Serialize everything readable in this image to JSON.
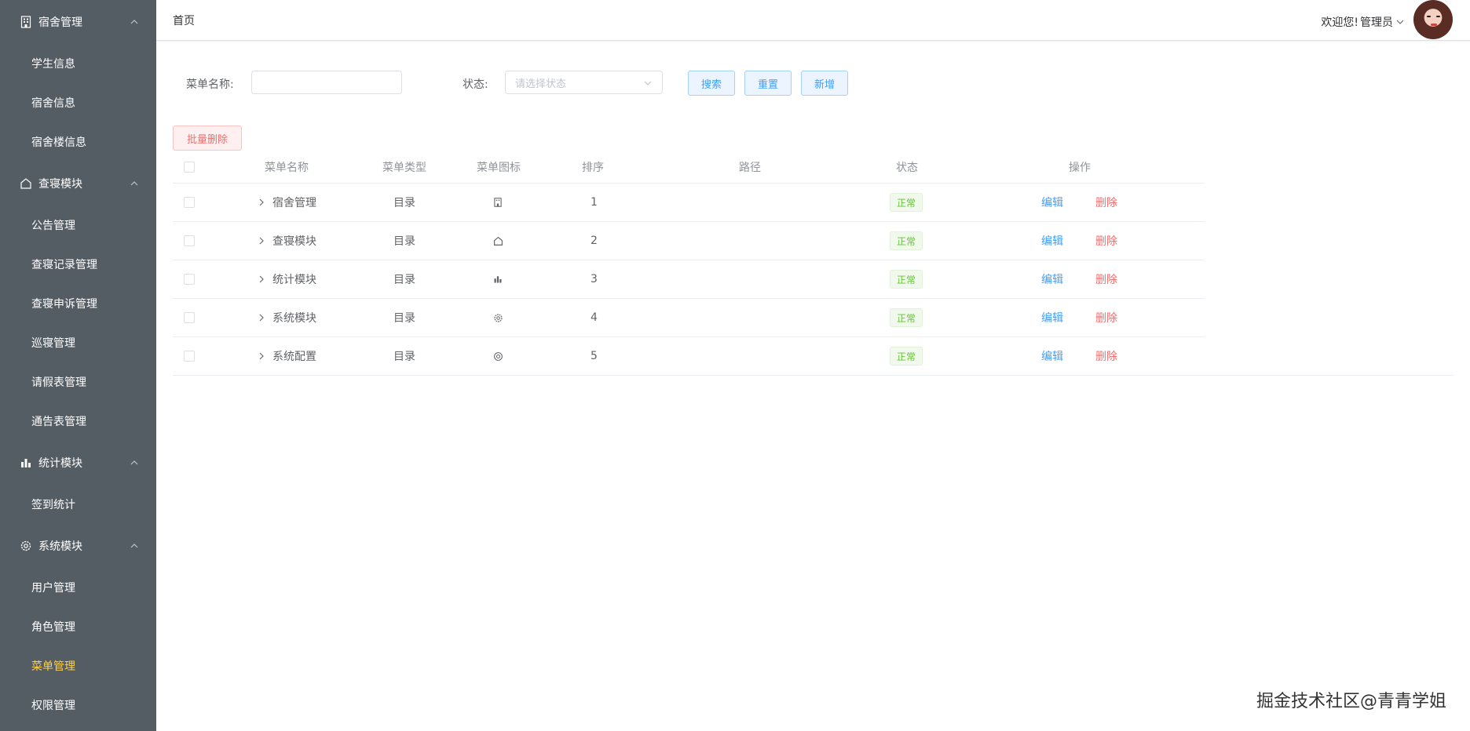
{
  "sidebar": {
    "groups": [
      {
        "label": "宿舍管理",
        "icon": "building-icon",
        "items": [
          "学生信息",
          "宿舍信息",
          "宿舍楼信息"
        ]
      },
      {
        "label": "查寝模块",
        "icon": "home-icon",
        "items": [
          "公告管理",
          "查寝记录管理",
          "查寝申诉管理",
          "巡寝管理",
          "请假表管理",
          "通告表管理"
        ]
      },
      {
        "label": "统计模块",
        "icon": "bar-chart-icon",
        "items": [
          "签到统计"
        ]
      },
      {
        "label": "系统模块",
        "icon": "gear-icon",
        "items": [
          "用户管理",
          "角色管理",
          "菜单管理",
          "权限管理"
        ]
      }
    ],
    "active_item": "菜单管理"
  },
  "header": {
    "breadcrumb": "首页",
    "welcome": "欢迎您!",
    "user": "管理员"
  },
  "search": {
    "name_label": "菜单名称:",
    "name_value": "",
    "status_label": "状态:",
    "status_placeholder": "请选择状态",
    "search_btn": "搜索",
    "reset_btn": "重置",
    "add_btn": "新增"
  },
  "batch_delete": "批量删除",
  "table": {
    "columns": [
      "菜单名称",
      "菜单类型",
      "菜单图标",
      "排序",
      "路径",
      "状态",
      "操作"
    ],
    "rows": [
      {
        "name": "宿舍管理",
        "type": "目录",
        "icon": "building-icon",
        "sort": "1",
        "path": "",
        "status": "正常"
      },
      {
        "name": "查寝模块",
        "type": "目录",
        "icon": "home-icon",
        "sort": "2",
        "path": "",
        "status": "正常"
      },
      {
        "name": "统计模块",
        "type": "目录",
        "icon": "bar-chart-icon",
        "sort": "3",
        "path": "",
        "status": "正常"
      },
      {
        "name": "系统模块",
        "type": "目录",
        "icon": "gear-icon",
        "sort": "4",
        "path": "",
        "status": "正常"
      },
      {
        "name": "系统配置",
        "type": "目录",
        "icon": "settings-icon",
        "sort": "5",
        "path": "",
        "status": "正常"
      }
    ],
    "edit_label": "编辑",
    "delete_label": "删除"
  },
  "watermark": "掘金技术社区@青青学姐"
}
